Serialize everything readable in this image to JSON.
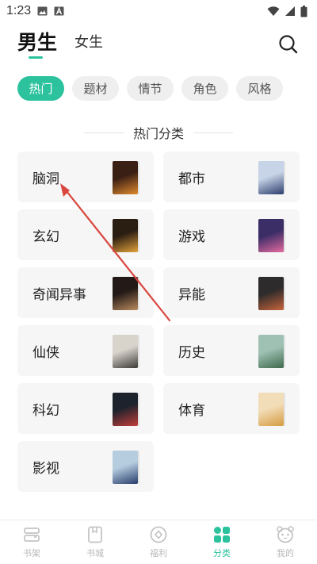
{
  "status_bar": {
    "time": "1:23"
  },
  "header": {
    "gender_tabs": [
      {
        "label": "男生",
        "active": true
      },
      {
        "label": "女生",
        "active": false
      }
    ],
    "search_icon": "search-icon"
  },
  "filters": {
    "chips": [
      {
        "label": "热门",
        "active": true
      },
      {
        "label": "题材",
        "active": false
      },
      {
        "label": "情节",
        "active": false
      },
      {
        "label": "角色",
        "active": false
      },
      {
        "label": "风格",
        "active": false
      }
    ]
  },
  "section": {
    "title": "热门分类"
  },
  "categories": [
    {
      "label": "脑洞",
      "cover_color": "#3a1f14",
      "cover_accent": "#e08a2e"
    },
    {
      "label": "都市",
      "cover_color": "#c7d3e6",
      "cover_accent": "#2b3d6e"
    },
    {
      "label": "玄幻",
      "cover_color": "#2a1d12",
      "cover_accent": "#e3a23b"
    },
    {
      "label": "游戏",
      "cover_color": "#3b2d66",
      "cover_accent": "#e46aa0"
    },
    {
      "label": "奇闻异事",
      "cover_color": "#231a17",
      "cover_accent": "#b98a5e"
    },
    {
      "label": "异能",
      "cover_color": "#2e2b2c",
      "cover_accent": "#c7643a"
    },
    {
      "label": "仙侠",
      "cover_color": "#d8d4cc",
      "cover_accent": "#3c3a38"
    },
    {
      "label": "历史",
      "cover_color": "#9fc1b4",
      "cover_accent": "#3e6a4c"
    },
    {
      "label": "科幻",
      "cover_color": "#1d232d",
      "cover_accent": "#c23d3a"
    },
    {
      "label": "体育",
      "cover_color": "#f2ddb9",
      "cover_accent": "#d59b3f"
    },
    {
      "label": "影视",
      "cover_color": "#b6cde0",
      "cover_accent": "#273c6a"
    }
  ],
  "bottom_nav": [
    {
      "label": "书架",
      "icon": "bookshelf-icon",
      "active": false
    },
    {
      "label": "书城",
      "icon": "bookstore-icon",
      "active": false
    },
    {
      "label": "福利",
      "icon": "welfare-icon",
      "active": false
    },
    {
      "label": "分类",
      "icon": "category-icon",
      "active": true
    },
    {
      "label": "我的",
      "icon": "profile-icon",
      "active": false
    }
  ],
  "colors": {
    "accent": "#2bc29d",
    "card_bg": "#f6f6f6",
    "annotation_arrow": "#d9473f"
  }
}
